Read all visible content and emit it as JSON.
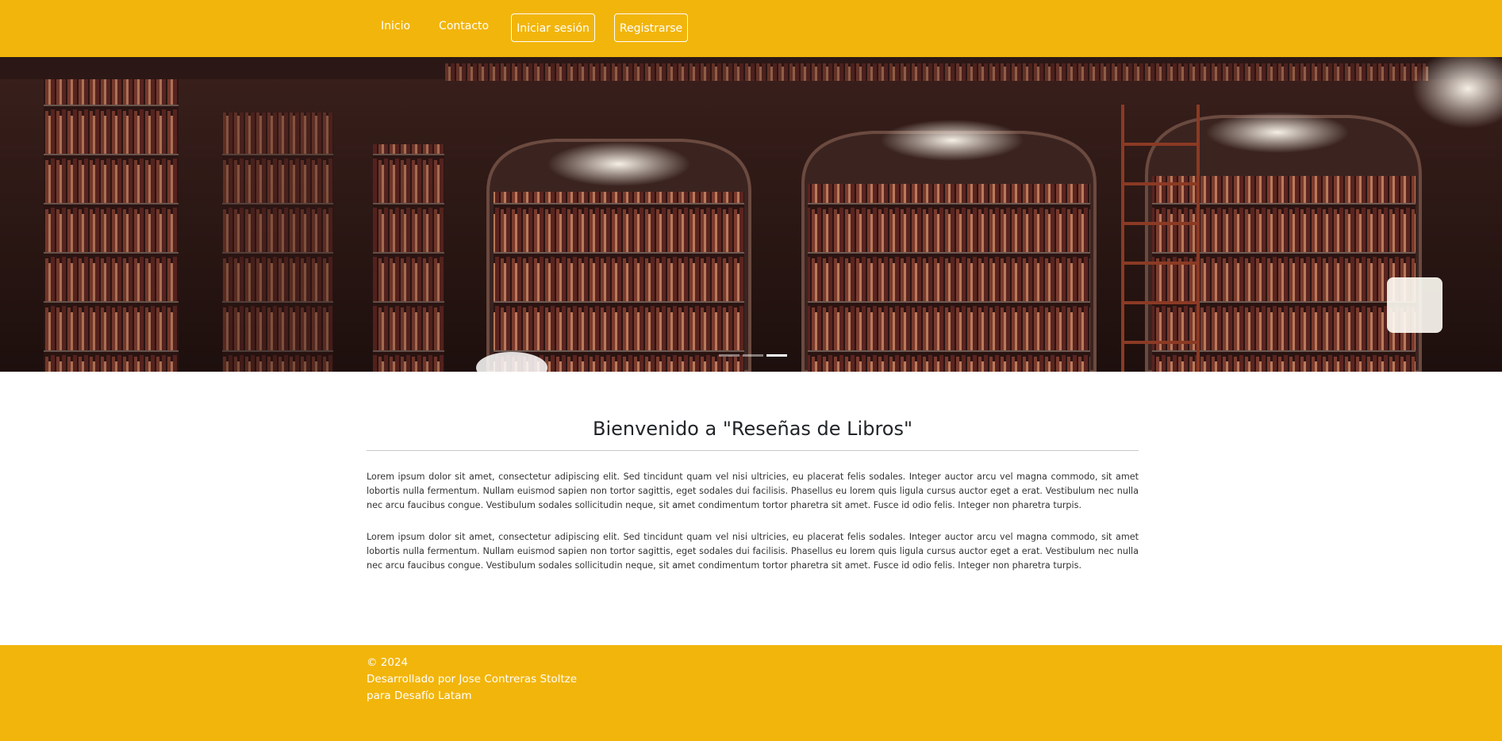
{
  "nav": {
    "inicio": "Inicio",
    "contacto": "Contacto",
    "login": "Iniciar sesión",
    "register": "Registrarse"
  },
  "hero": {
    "image": "library-bookshelves-photo",
    "indicators": 3,
    "active_indicator": 3
  },
  "main": {
    "title": "Bienvenido a \"Reseñas de Libros\"",
    "paragraphs": [
      "Lorem ipsum dolor sit amet, consectetur adipiscing elit. Sed tincidunt quam vel nisi ultricies, eu placerat felis sodales. Integer auctor arcu vel magna commodo, sit amet lobortis nulla fermentum. Nullam euismod sapien non tortor sagittis, eget sodales dui facilisis. Phasellus eu lorem quis ligula cursus auctor eget a erat. Vestibulum nec nulla nec arcu faucibus congue. Vestibulum sodales sollicitudin neque, sit amet condimentum tortor pharetra sit amet. Fusce id odio felis. Integer non pharetra turpis.",
      "Lorem ipsum dolor sit amet, consectetur adipiscing elit. Sed tincidunt quam vel nisi ultricies, eu placerat felis sodales. Integer auctor arcu vel magna commodo, sit amet lobortis nulla fermentum. Nullam euismod sapien non tortor sagittis, eget sodales dui facilisis. Phasellus eu lorem quis ligula cursus auctor eget a erat. Vestibulum nec nulla nec arcu faucibus congue. Vestibulum sodales sollicitudin neque, sit amet condimentum tortor pharetra sit amet. Fusce id odio felis. Integer non pharetra turpis."
    ]
  },
  "footer": {
    "copyright": "© 2024",
    "developed_by": "Desarrollado por Jose Contreras Stoltze",
    "for": "para Desafío Latam"
  },
  "colors": {
    "brand": "#f2b50b",
    "text": "#212529"
  }
}
